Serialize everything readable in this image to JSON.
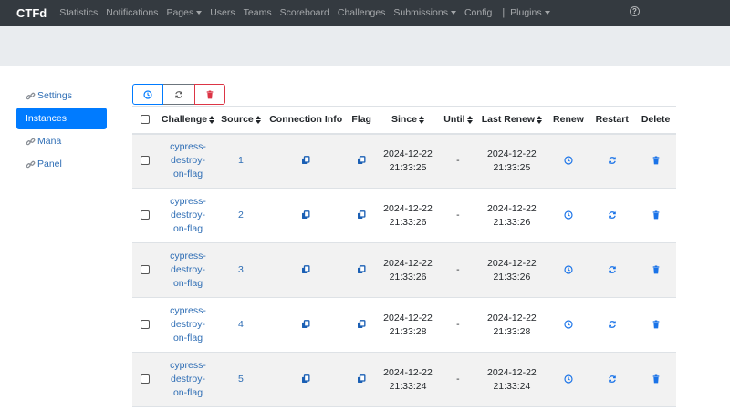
{
  "navbar": {
    "brand": "CTFd",
    "items": [
      {
        "label": "Statistics",
        "dropdown": false
      },
      {
        "label": "Notifications",
        "dropdown": false
      },
      {
        "label": "Pages",
        "dropdown": true
      },
      {
        "label": "Users",
        "dropdown": false
      },
      {
        "label": "Teams",
        "dropdown": false
      },
      {
        "label": "Scoreboard",
        "dropdown": false
      },
      {
        "label": "Challenges",
        "dropdown": false
      },
      {
        "label": "Submissions",
        "dropdown": true
      },
      {
        "label": "Config",
        "dropdown": false
      }
    ],
    "separator": "|",
    "plugins": {
      "label": "Plugins",
      "dropdown": true
    },
    "help_icon": "question-circle-icon"
  },
  "sidebar": {
    "items": [
      {
        "label": "Settings",
        "icon": "link-icon",
        "active": false
      },
      {
        "label": "Instances",
        "icon": "",
        "active": true
      },
      {
        "label": "Mana",
        "icon": "link-icon",
        "active": false
      },
      {
        "label": "Panel",
        "icon": "link-icon",
        "active": false
      }
    ]
  },
  "actions": {
    "buttons": [
      {
        "icon": "clock-icon",
        "color": "#007bff"
      },
      {
        "icon": "sync-icon",
        "color": "#6c757d"
      },
      {
        "icon": "trash-icon",
        "color": "#dc3545"
      }
    ]
  },
  "table": {
    "headers": {
      "challenge": "Challenge",
      "source": "Source",
      "connection_info": "Connection Info",
      "flag": "Flag",
      "since": "Since",
      "until": "Until",
      "last_renew": "Last Renew",
      "renew": "Renew",
      "restart": "Restart",
      "delete": "Delete"
    },
    "rows": [
      {
        "challenge": [
          "cypress-",
          "destroy-",
          "on-flag"
        ],
        "source": "1",
        "since": [
          "2024-12-22",
          "21:33:25"
        ],
        "until": "-",
        "last_renew": [
          "2024-12-22",
          "21:33:25"
        ]
      },
      {
        "challenge": [
          "cypress-",
          "destroy-",
          "on-flag"
        ],
        "source": "2",
        "since": [
          "2024-12-22",
          "21:33:26"
        ],
        "until": "-",
        "last_renew": [
          "2024-12-22",
          "21:33:26"
        ]
      },
      {
        "challenge": [
          "cypress-",
          "destroy-",
          "on-flag"
        ],
        "source": "3",
        "since": [
          "2024-12-22",
          "21:33:26"
        ],
        "until": "-",
        "last_renew": [
          "2024-12-22",
          "21:33:26"
        ]
      },
      {
        "challenge": [
          "cypress-",
          "destroy-",
          "on-flag"
        ],
        "source": "4",
        "since": [
          "2024-12-22",
          "21:33:28"
        ],
        "until": "-",
        "last_renew": [
          "2024-12-22",
          "21:33:28"
        ]
      },
      {
        "challenge": [
          "cypress-",
          "destroy-",
          "on-flag"
        ],
        "source": "5",
        "since": [
          "2024-12-22",
          "21:33:24"
        ],
        "until": "-",
        "last_renew": [
          "2024-12-22",
          "21:33:24"
        ]
      }
    ]
  },
  "colors": {
    "link": "#2f6eb5",
    "primary": "#007bff",
    "danger": "#dc3545",
    "navbar": "#343a40",
    "jumbotron": "#e9ecef"
  }
}
